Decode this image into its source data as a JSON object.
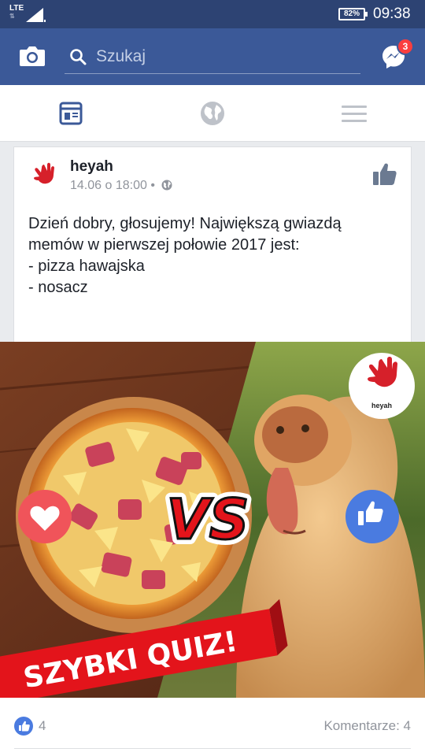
{
  "status_bar": {
    "network": "LTE",
    "battery": "82%",
    "time": "09:38"
  },
  "top_bar": {
    "search_placeholder": "Szukaj",
    "messenger_badge": "3"
  },
  "tabs": [
    {
      "name": "news-feed",
      "active": true
    },
    {
      "name": "notifications-globe",
      "active": false
    },
    {
      "name": "menu",
      "active": false
    }
  ],
  "post": {
    "page_name": "heyah",
    "timestamp": "14.06 o 18:00",
    "separator": "•",
    "text": "Dzień dobry, głosujemy! Największą gwiazdą memów w pierwszej połowie 2017 jest:\n- pizza hawajska\n- nosacz",
    "image": {
      "vs_text": "VS",
      "banner_text": "SZYBKI QUIZ!",
      "logo_text": "heyah",
      "left_reaction": "heart-icon",
      "right_reaction": "thumbs-up-icon"
    },
    "likes": "4",
    "comments": "Komentarze: 4"
  },
  "colors": {
    "facebook_blue": "#3b5998",
    "status_bar": "#2d4373",
    "badge_red": "#fa3e3e",
    "banner_red": "#e3141b",
    "heart_red": "#f0545a",
    "like_blue": "#4a7be0"
  }
}
